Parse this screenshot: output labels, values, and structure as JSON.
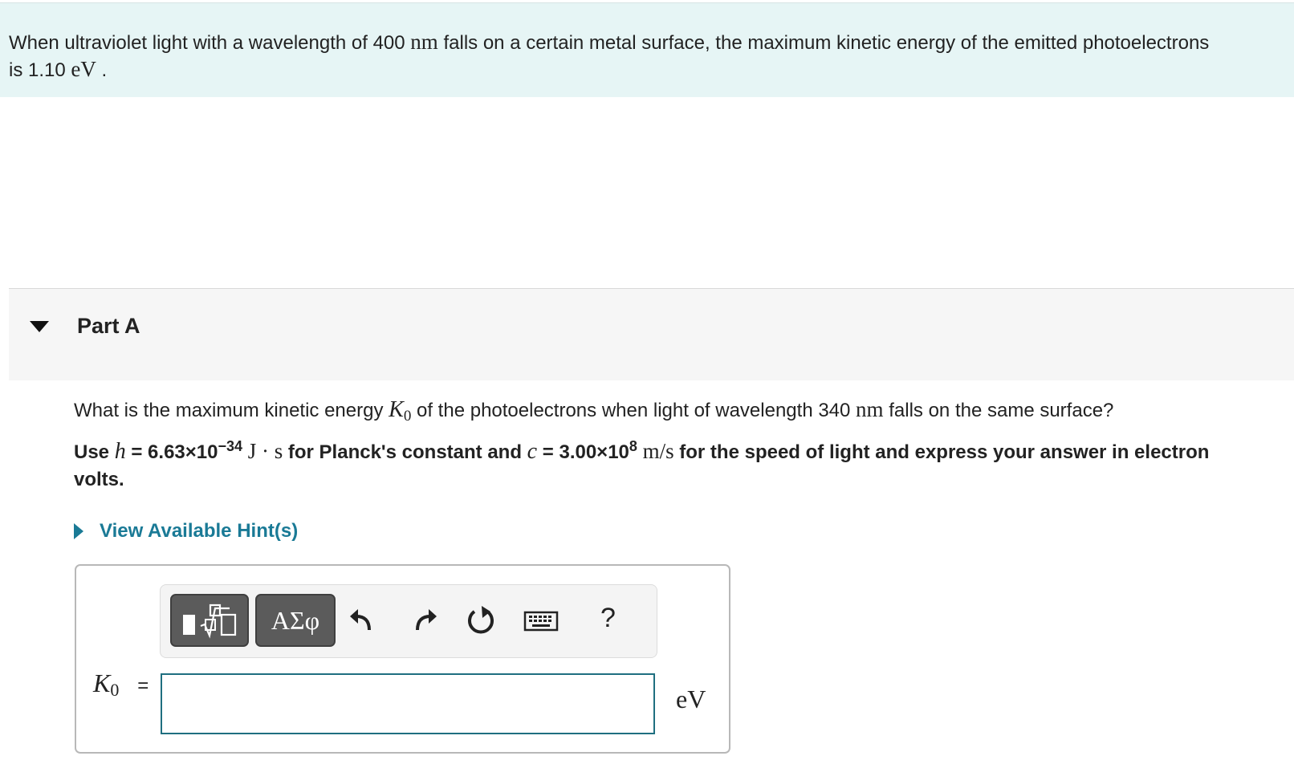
{
  "intro": {
    "text_1": "When ultraviolet light with a wavelength of 400",
    "unit_nm": "nm",
    "text_2": "falls on a certain metal surface, the maximum kinetic energy of the emitted photoelectrons is 1.10",
    "unit_ev": "eV",
    "text_3": "."
  },
  "part": {
    "title": "Part A",
    "question_1": "What is the maximum kinetic energy",
    "k_symbol": "K",
    "k_sub": "0",
    "question_2": "of the photoelectrons when light of wavelength 340",
    "question_unit": "nm",
    "question_3": "falls on the same surface?",
    "instr_use": "Use",
    "h_symbol": "h",
    "h_value": "= 6.63×10",
    "h_exp": "−34",
    "h_unit": "J · s",
    "instr_mid": "for Planck's constant and",
    "c_symbol": "c",
    "c_value": "= 3.00×10",
    "c_exp": "8",
    "c_unit": "m/s",
    "instr_end": "for the speed of light and express your answer in electron volts.",
    "hint_label": "View Available Hint(s)"
  },
  "toolbar": {
    "greek_label": "ΑΣφ",
    "help_label": "?",
    "icons": [
      "template-icon",
      "undo-icon",
      "redo-icon",
      "reset-icon",
      "keyboard-icon",
      "help-icon"
    ]
  },
  "answer": {
    "label_symbol": "K",
    "label_sub": "0",
    "equals": "=",
    "input_value": "",
    "unit": "eV"
  },
  "colors": {
    "intro_bg": "#e6f5f5",
    "part_header_bg": "#f6f6f6",
    "hint_color": "#1a7a96",
    "input_border": "#1f6f80",
    "toolbar_button": "#5b5b5b"
  }
}
